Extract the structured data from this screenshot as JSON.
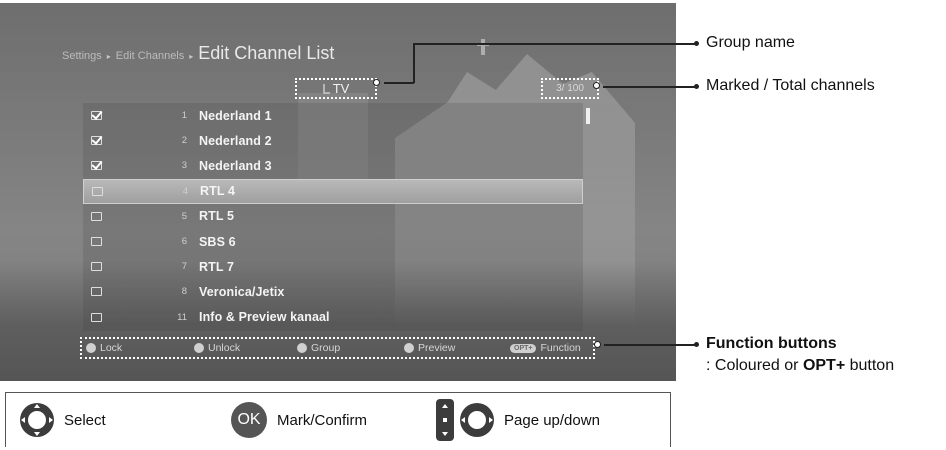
{
  "screen": {
    "breadcrumb": {
      "items": [
        "Settings",
        "Edit Channels"
      ],
      "current": "Edit Channel List"
    },
    "group_name": "TV",
    "marked_total": "3/ 100",
    "channels": [
      {
        "checked": true,
        "number": "1",
        "name": "Nederland 1",
        "selected": false
      },
      {
        "checked": true,
        "number": "2",
        "name": "Nederland 2",
        "selected": false
      },
      {
        "checked": true,
        "number": "3",
        "name": "Nederland 3",
        "selected": false
      },
      {
        "checked": false,
        "number": "4",
        "name": "RTL 4",
        "selected": true
      },
      {
        "checked": false,
        "number": "5",
        "name": "RTL 5",
        "selected": false
      },
      {
        "checked": false,
        "number": "6",
        "name": "SBS 6",
        "selected": false
      },
      {
        "checked": false,
        "number": "7",
        "name": "RTL 7",
        "selected": false
      },
      {
        "checked": false,
        "number": "8",
        "name": "Veronica/Jetix",
        "selected": false
      },
      {
        "checked": false,
        "number": "11",
        "name": "Info & Preview kanaal",
        "selected": false
      }
    ],
    "function_buttons": {
      "lock": "Lock",
      "unlock": "Unlock",
      "group": "Group",
      "preview": "Preview",
      "opt_badge": "OPT+",
      "function": "Function"
    }
  },
  "callouts": {
    "group_name": "Group name",
    "marked_total": "Marked / Total channels",
    "function_buttons_title": "Function buttons",
    "function_buttons_desc_prefix": ": Coloured or ",
    "function_buttons_desc_bold": "OPT+",
    "function_buttons_desc_suffix": " button"
  },
  "legend": {
    "select": "Select",
    "ok_glyph": "OK",
    "mark_confirm": "Mark/Confirm",
    "page_updown": "Page up/down"
  }
}
